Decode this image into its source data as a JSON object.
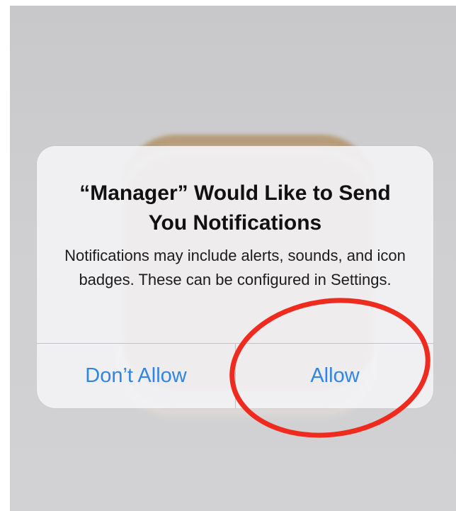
{
  "alert": {
    "title": "“Manager” Would Like to Send You Notifications",
    "message": "Notifications may include alerts, sounds, and icon badges. These can be configured in Settings.",
    "deny_label": "Don’t Allow",
    "allow_label": "Allow"
  },
  "icons": {
    "app_icon": "app-icon"
  },
  "colors": {
    "button_text": "#2f86e6",
    "annotation": "#ee2b1e",
    "backdrop": "#cfcfd1",
    "alert_bg": "#f2f2f4"
  }
}
